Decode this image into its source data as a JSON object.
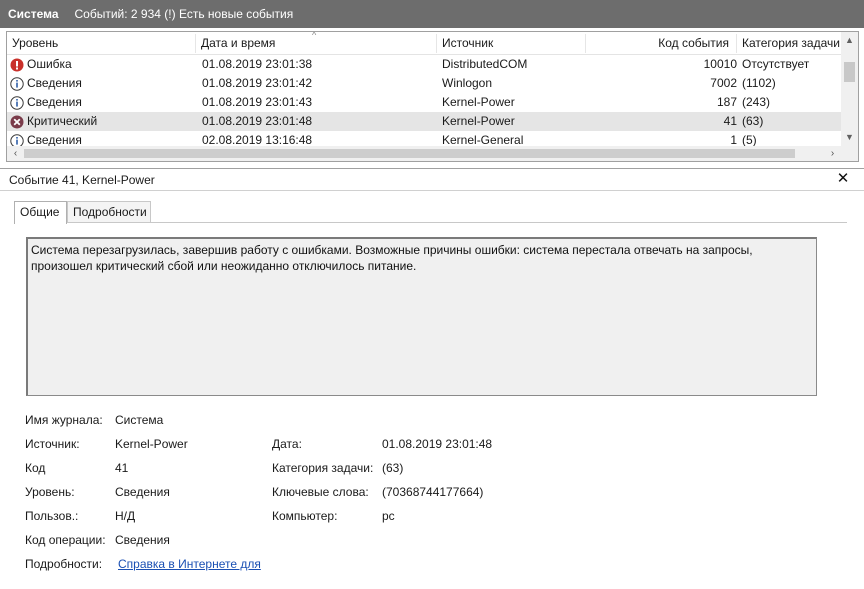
{
  "titlebar": {
    "title": "Система",
    "info": "Событий: 2 934 (!) Есть новые события"
  },
  "grid": {
    "columns": [
      "Уровень",
      "Дата и время",
      "Источник",
      "Код события",
      "Категория задачи"
    ],
    "rows": [
      {
        "level": "Ошибка",
        "icon": "error-icon",
        "date": "01.08.2019 23:01:38",
        "source": "DistributedCOM",
        "code": "10010",
        "category": "Отсутствует"
      },
      {
        "level": "Сведения",
        "icon": "info-icon",
        "date": "01.08.2019 23:01:42",
        "source": "Winlogon",
        "code": "7002",
        "category": "(1102)"
      },
      {
        "level": "Сведения",
        "icon": "info-icon",
        "date": "01.08.2019 23:01:43",
        "source": "Kernel-Power",
        "code": "187",
        "category": "(243)"
      },
      {
        "level": "Критический",
        "icon": "critical-icon",
        "date": "01.08.2019 23:01:48",
        "source": "Kernel-Power",
        "code": "41",
        "category": "(63)"
      },
      {
        "level": "Сведения",
        "icon": "info-icon",
        "date": "02.08.2019 13:16:48",
        "source": "Kernel-General",
        "code": "1",
        "category": "(5)"
      }
    ]
  },
  "detail": {
    "title": "Событие 41, Kernel-Power",
    "close_label": "✕",
    "tabs": [
      "Общие",
      "Подробности"
    ],
    "message": "Система перезагрузилась, завершив работу с ошибками. Возможные причины ошибки: система перестала отвечать на запросы, произошел критический сбой или неожиданно отключилось питание.",
    "props": {
      "log_label": "Имя журнала:",
      "log_value": "Система",
      "source_label": "Источник:",
      "source_value": "Kernel-Power",
      "date_label": "Дата:",
      "date_value": "01.08.2019 23:01:48",
      "code_label": "Код",
      "code_value": "41",
      "category_label": "Категория задачи:",
      "category_value": "(63)",
      "level_label": "Уровень:",
      "level_value": "Сведения",
      "keywords_label": "Ключевые слова:",
      "keywords_value": "(70368744177664)",
      "user_label": "Пользов.:",
      "user_value": "Н/Д",
      "computer_label": "Компьютер:",
      "computer_value": "pc",
      "opcode_label": "Код операции:",
      "opcode_value": "Сведения",
      "details_label": "Подробности:",
      "details_link": "Справка в Интернете для"
    }
  },
  "colors": {
    "titlebar_bg": "#6d6d6d",
    "error_red": "#c9312b",
    "critical_gray_red": "#7a3b4a",
    "info_blue": "#2f5fa8",
    "link_blue": "#1a4fb3",
    "selected_row": "#e5e5e5"
  }
}
